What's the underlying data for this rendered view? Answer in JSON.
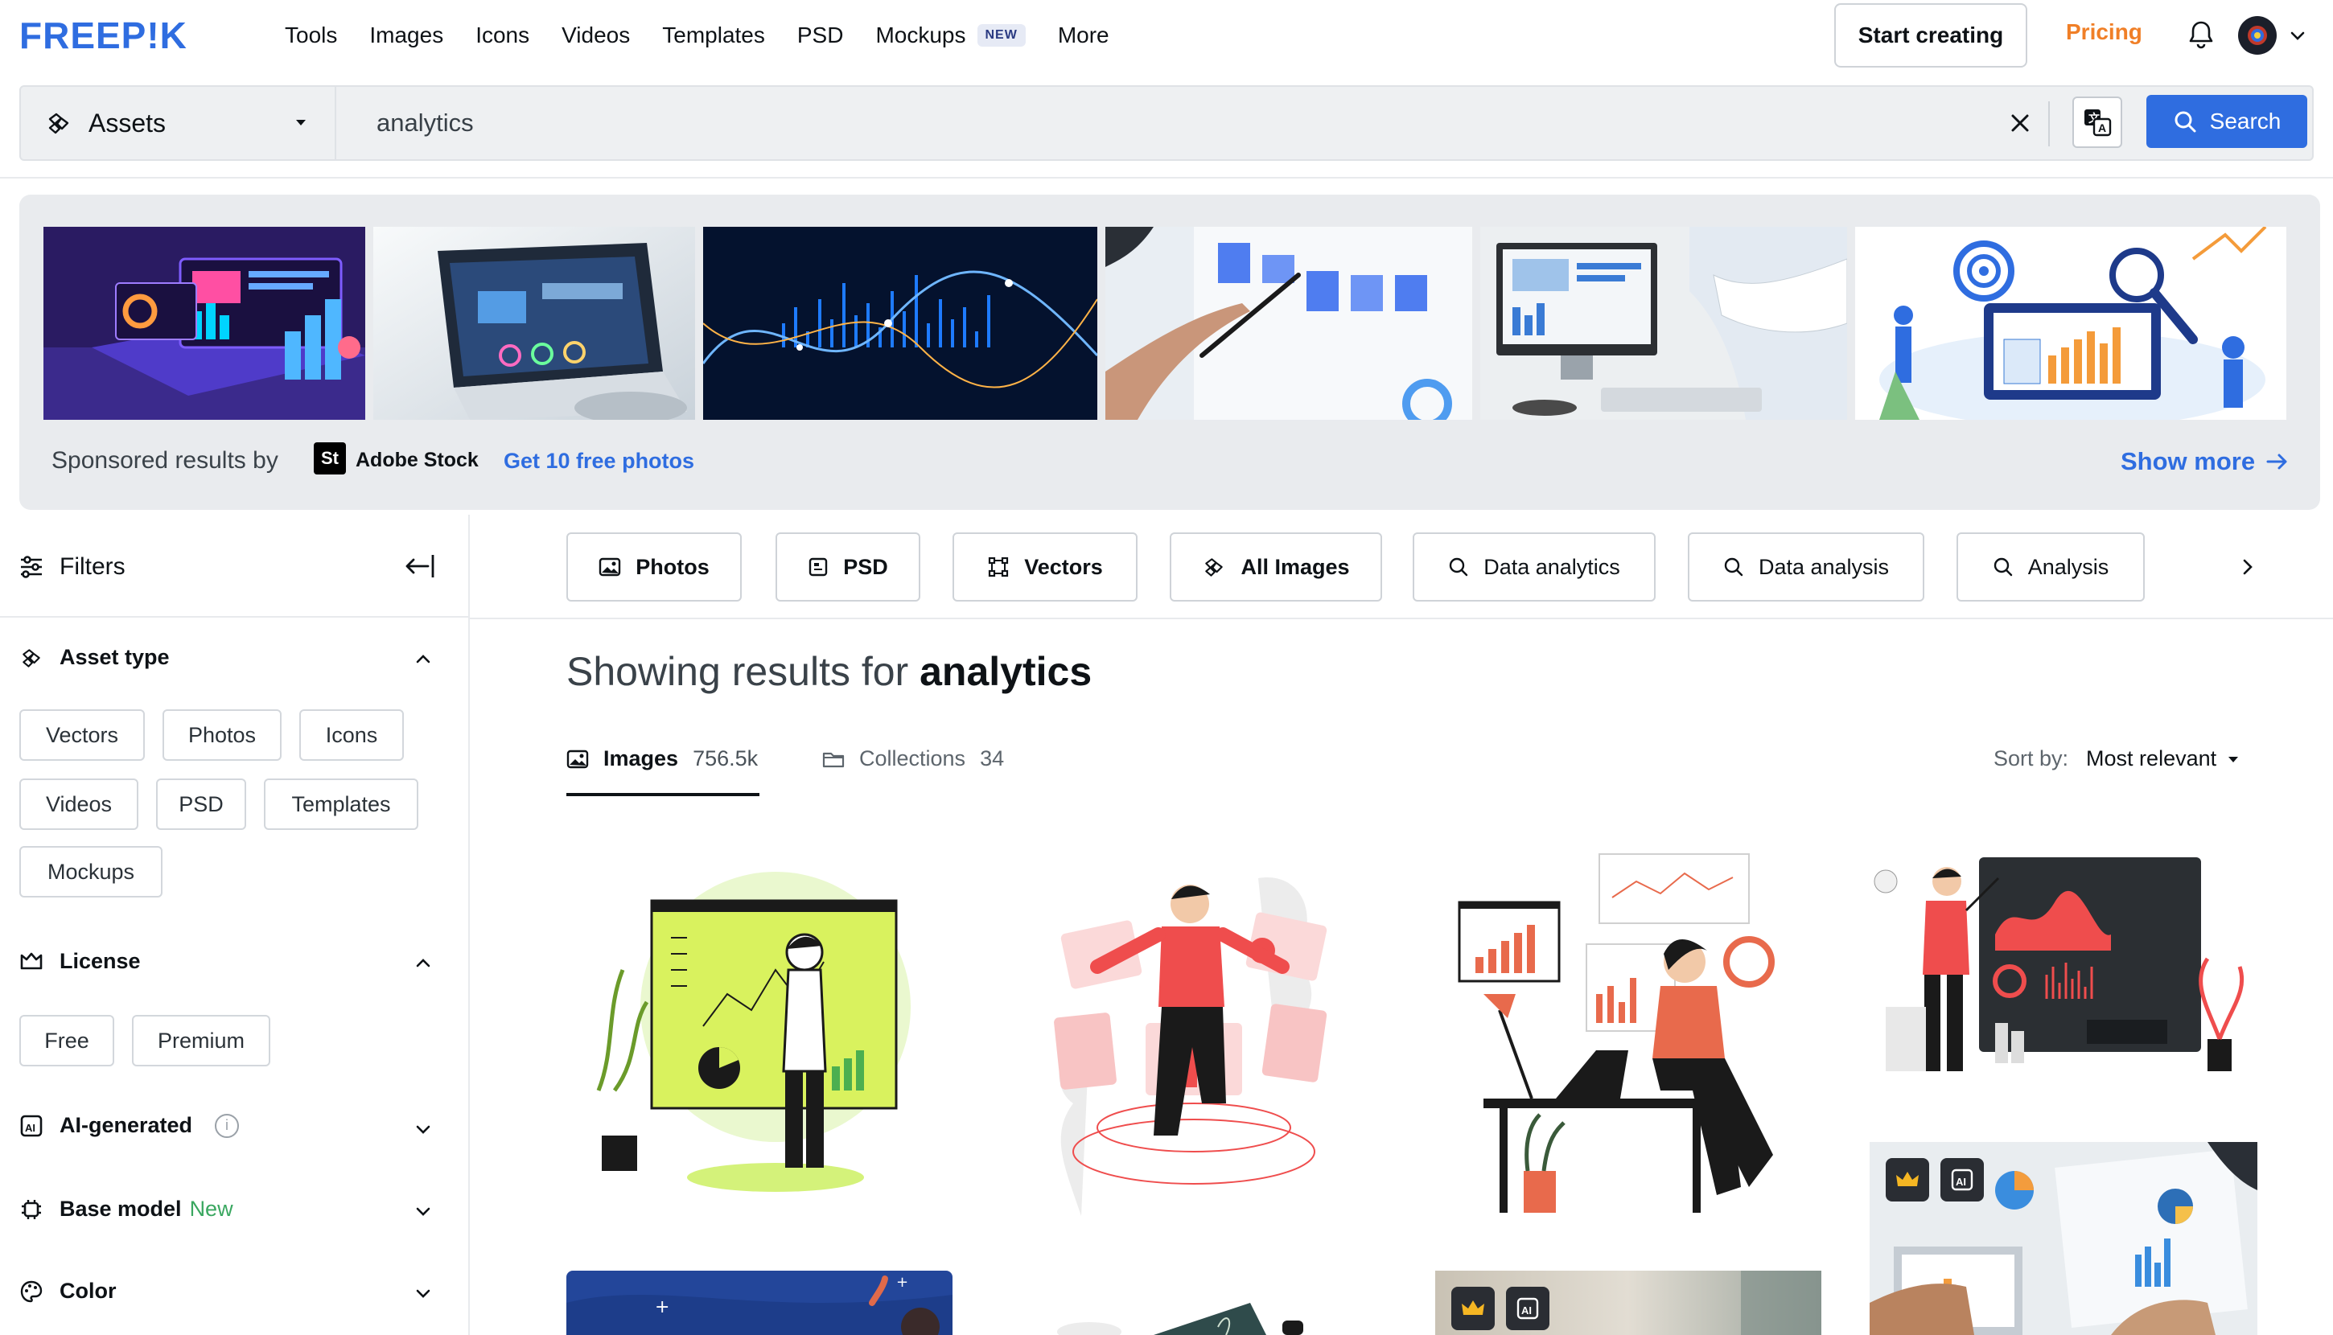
{
  "brand": {
    "logo_text": "FREEPIK",
    "accent": "#2f6de0",
    "pricing_color": "#f07f27"
  },
  "nav": {
    "links": [
      {
        "label": "Tools"
      },
      {
        "label": "Images"
      },
      {
        "label": "Icons"
      },
      {
        "label": "Videos"
      },
      {
        "label": "Templates"
      },
      {
        "label": "PSD"
      },
      {
        "label": "Mockups",
        "badge": "NEW"
      },
      {
        "label": "More"
      }
    ],
    "start_creating": "Start creating",
    "pricing": "Pricing",
    "icons": {
      "bell": "bell-icon",
      "avatar": "avatar",
      "caret": "chevron-down-icon"
    }
  },
  "search": {
    "asset_type": "Assets",
    "query": "analytics",
    "button": "Search"
  },
  "sponsored": {
    "label": "Sponsored results by",
    "provider_logo": "St",
    "provider": "Adobe Stock",
    "promo": "Get 10 free photos",
    "show_more": "Show more"
  },
  "sidebar": {
    "title": "Filters",
    "asset_type": {
      "title": "Asset type",
      "chips": [
        "Vectors",
        "Photos",
        "Icons",
        "Videos",
        "PSD",
        "Templates",
        "Mockups"
      ]
    },
    "license": {
      "title": "License",
      "chips": [
        "Free",
        "Premium"
      ]
    },
    "ai_generated": {
      "title": "AI-generated",
      "info": "i"
    },
    "base_model": {
      "title": "Base model",
      "tag": "New"
    },
    "color": {
      "title": "Color"
    }
  },
  "tags": [
    {
      "label": "Photos",
      "icon": "image-icon"
    },
    {
      "label": "PSD",
      "icon": "psd-icon"
    },
    {
      "label": "Vectors",
      "icon": "vector-icon"
    },
    {
      "label": "All Images",
      "icon": "assets-icon"
    },
    {
      "label": "Data analytics",
      "icon": "search-icon"
    },
    {
      "label": "Data analysis",
      "icon": "search-icon"
    },
    {
      "label": "Analysis",
      "icon": "search-icon"
    }
  ],
  "results": {
    "prefix": "Showing results for",
    "query": "analytics",
    "tabs": {
      "images_label": "Images",
      "images_count": "756.5k",
      "collections_label": "Collections",
      "collections_count": "34"
    },
    "sort_label": "Sort by:",
    "sort_value": "Most relevant"
  }
}
